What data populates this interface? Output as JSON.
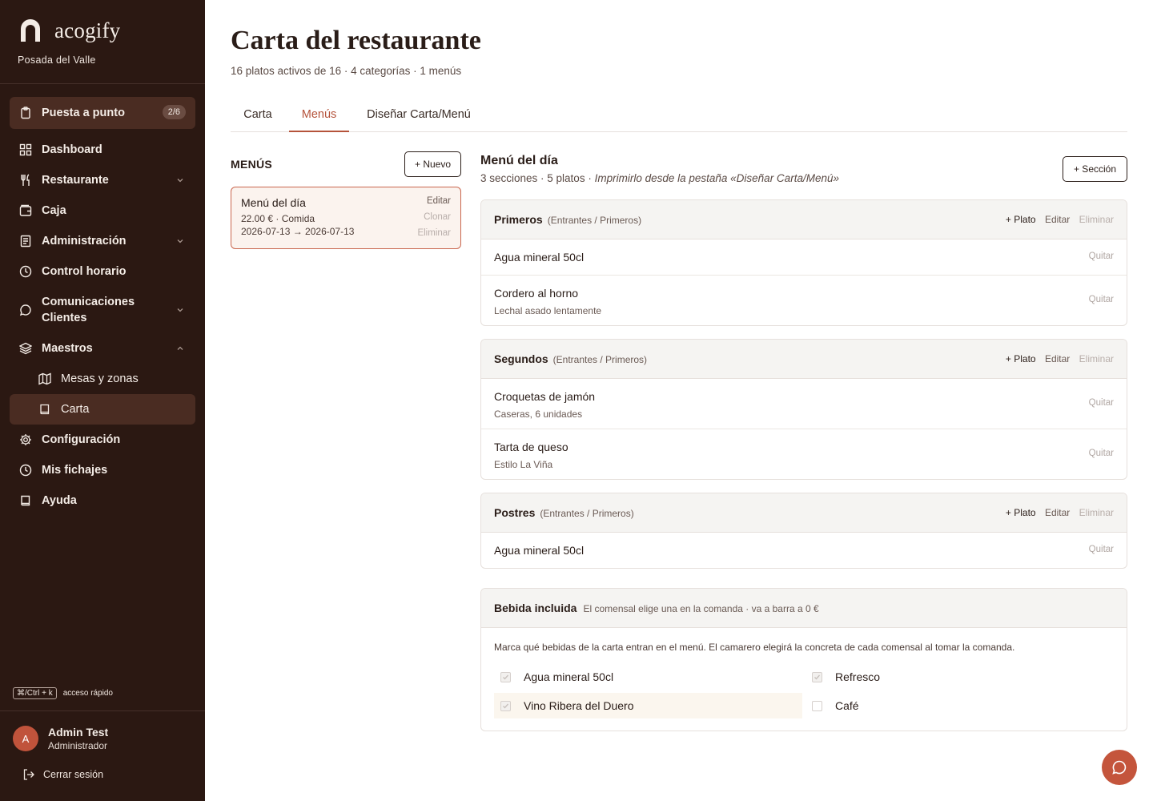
{
  "brand": {
    "name": "acogify",
    "subtitle": "Posada del Valle"
  },
  "sidebar": {
    "setup": {
      "label": "Puesta a punto",
      "badge": "2/6"
    },
    "items": [
      {
        "label": "Dashboard"
      },
      {
        "label": "Restaurante"
      },
      {
        "label": "Caja"
      },
      {
        "label": "Administración"
      },
      {
        "label": "Control horario"
      },
      {
        "label": "Comunicaciones Clientes"
      },
      {
        "label": "Maestros"
      },
      {
        "label": "Mesas y zonas"
      },
      {
        "label": "Carta"
      },
      {
        "label": "Configuración"
      },
      {
        "label": "Mis fichajes"
      },
      {
        "label": "Ayuda"
      }
    ],
    "quick_key": "⌘/Ctrl + k",
    "quick_label": "acceso rápido",
    "user": {
      "initial": "A",
      "name": "Admin Test",
      "role": "Administrador"
    },
    "logout": "Cerrar sesión"
  },
  "page": {
    "title": "Carta del restaurante",
    "subtitle": "16 platos activos de 16 · 4 categorías · 1 menús",
    "tabs": [
      {
        "label": "Carta"
      },
      {
        "label": "Menús"
      },
      {
        "label": "Diseñar Carta/Menú"
      }
    ],
    "active_tab": "Menús"
  },
  "menus_panel": {
    "heading": "MENÚS",
    "new_button": "+ Nuevo",
    "card": {
      "name": "Menú del día",
      "line2": "22.00 € · Comida",
      "line3": "2026-07-13 → 2026-07-13",
      "edit": "Editar",
      "clone": "Clonar",
      "delete": "Eliminar"
    }
  },
  "detail": {
    "title": "Menú del día",
    "subtitle_plain": "3 secciones · 5 platos · ",
    "subtitle_italic": "Imprimirlo desde la pestaña «Diseñar Carta/Menú»",
    "add_section": "+ Sección",
    "sections": [
      {
        "name": "Primeros",
        "category": "(Entrantes / Primeros)",
        "add": "+ Plato",
        "edit": "Editar",
        "delete": "Eliminar",
        "dishes": [
          {
            "name": "Agua mineral 50cl",
            "desc": "",
            "remove": "Quitar"
          },
          {
            "name": "Cordero al horno",
            "desc": "Lechal asado lentamente",
            "remove": "Quitar"
          }
        ]
      },
      {
        "name": "Segundos",
        "category": "(Entrantes / Primeros)",
        "add": "+ Plato",
        "edit": "Editar",
        "delete": "Eliminar",
        "dishes": [
          {
            "name": "Croquetas de jamón",
            "desc": "Caseras, 6 unidades",
            "remove": "Quitar"
          },
          {
            "name": "Tarta de queso",
            "desc": "Estilo La Viña",
            "remove": "Quitar"
          }
        ]
      },
      {
        "name": "Postres",
        "category": "(Entrantes / Primeros)",
        "add": "+ Plato",
        "edit": "Editar",
        "delete": "Eliminar",
        "dishes": [
          {
            "name": "Agua mineral 50cl",
            "desc": "",
            "remove": "Quitar"
          }
        ]
      }
    ],
    "bebida": {
      "title": "Bebida incluida",
      "note": "El comensal elige una en la comanda · va a barra a 0 €",
      "intro": "Marca qué bebidas de la carta entran en el menú. El camarero elegirá la concreta de cada comensal al tomar la comanda.",
      "options": [
        {
          "label": "Agua mineral 50cl",
          "checked": true
        },
        {
          "label": "Refresco",
          "checked": true
        },
        {
          "label": "Vino Ribera del Duero",
          "checked": true
        },
        {
          "label": "Café",
          "checked": false
        }
      ]
    }
  },
  "colors": {
    "sidebar_bg": "#2b1812",
    "accent": "#b5533b",
    "fab": "#c4553c"
  },
  "icons": {
    "setup": "clipboard-icon",
    "dashboard": "grid-icon",
    "restaurante": "utensils-icon",
    "caja": "wallet-icon",
    "administracion": "document-icon",
    "control": "clock-icon",
    "comunicaciones": "chat-bubble-icon",
    "maestros": "layers-icon",
    "mesas": "map-icon",
    "carta": "book-icon",
    "configuracion": "gear-icon",
    "fichajes": "clock-icon",
    "ayuda": "book-icon",
    "logout": "logout-icon",
    "fab": "chat-bubble-icon"
  }
}
